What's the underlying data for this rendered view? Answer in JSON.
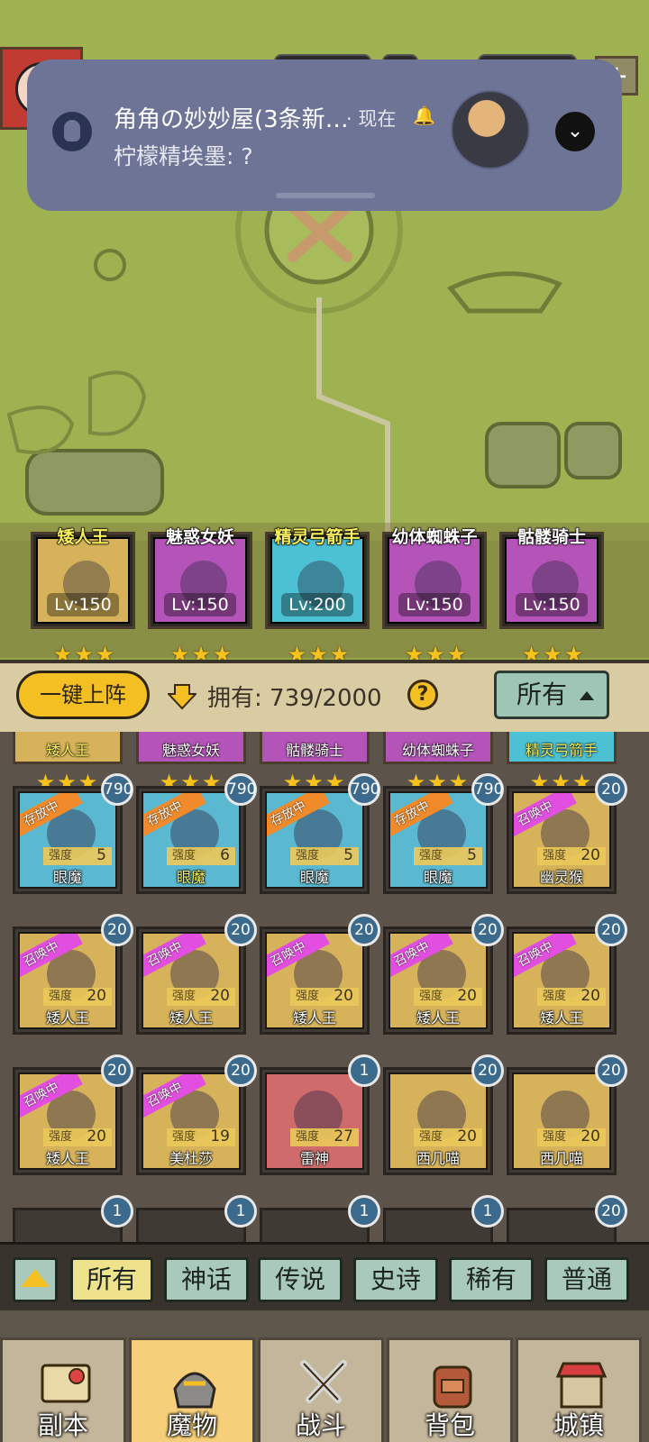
{
  "notification": {
    "title": "角角の妙妙屋(3条新…",
    "meta": "· 现在",
    "message": "柠檬精埃墨: ?"
  },
  "lineup": [
    {
      "name": "矮人王",
      "level": "Lv:150",
      "stars": "★★★",
      "name_color": "#f7f05c",
      "bg": "#d6b35a"
    },
    {
      "name": "魅惑女妖",
      "level": "Lv:150",
      "stars": "★★★",
      "name_color": "#ffffff",
      "bg": "#b454b8"
    },
    {
      "name": "精灵弓箭手",
      "level": "Lv:200",
      "stars": "★★★",
      "name_color": "#f7f05c",
      "bg": "#4cc1d4"
    },
    {
      "name": "幼体蜘蛛子",
      "level": "Lv:150",
      "stars": "★★★",
      "name_color": "#ffffff",
      "bg": "#b454b8"
    },
    {
      "name": "骷髅骑士",
      "level": "Lv:150",
      "stars": "★★★",
      "name_color": "#ffffff",
      "bg": "#b454b8"
    }
  ],
  "controls": {
    "deploy_label": "一键上阵",
    "owned_text": "拥有: 739/2000",
    "help": "?",
    "filter_label": "所有"
  },
  "partial_row": [
    {
      "name": "矮人王",
      "color": "#f7f05c",
      "bg": "#d6b35a"
    },
    {
      "name": "魅惑女妖",
      "color": "#ffffff",
      "bg": "#b454b8"
    },
    {
      "name": "骷髅骑士",
      "color": "#ffffff",
      "bg": "#b454b8"
    },
    {
      "name": "幼体蜘蛛子",
      "color": "#ffffff",
      "bg": "#b454b8"
    },
    {
      "name": "精灵弓箭手",
      "color": "#f7f05c",
      "bg": "#4cc1d4"
    }
  ],
  "partial_stars": "★★★",
  "strength_label": "强度",
  "monsters": [
    [
      {
        "name": "眼魔",
        "strength": "5",
        "badge": "790",
        "status": "存放中",
        "bg": "#5ab8d0",
        "name_color": "#ffffff"
      },
      {
        "name": "眼魔",
        "strength": "6",
        "badge": "790",
        "status": "存放中",
        "bg": "#5ab8d0",
        "name_color": "#f7f05c"
      },
      {
        "name": "眼魔",
        "strength": "5",
        "badge": "790",
        "status": "存放中",
        "bg": "#5ab8d0",
        "name_color": "#ffffff"
      },
      {
        "name": "眼魔",
        "strength": "5",
        "badge": "790",
        "status": "存放中",
        "bg": "#5ab8d0",
        "name_color": "#ffffff"
      },
      {
        "name": "幽灵猴",
        "strength": "20",
        "badge": "20",
        "status": "召唤中",
        "bg": "#d6b35a",
        "name_color": "#ffffff"
      }
    ],
    [
      {
        "name": "矮人王",
        "strength": "20",
        "badge": "20",
        "status": "召唤中",
        "bg": "#d6b35a",
        "name_color": "#ffffff"
      },
      {
        "name": "矮人王",
        "strength": "20",
        "badge": "20",
        "status": "召唤中",
        "bg": "#d6b35a",
        "name_color": "#ffffff"
      },
      {
        "name": "矮人王",
        "strength": "20",
        "badge": "20",
        "status": "召唤中",
        "bg": "#d6b35a",
        "name_color": "#ffffff"
      },
      {
        "name": "矮人王",
        "strength": "20",
        "badge": "20",
        "status": "召唤中",
        "bg": "#d6b35a",
        "name_color": "#ffffff"
      },
      {
        "name": "矮人王",
        "strength": "20",
        "badge": "20",
        "status": "召唤中",
        "bg": "#d6b35a",
        "name_color": "#ffffff"
      }
    ],
    [
      {
        "name": "矮人王",
        "strength": "20",
        "badge": "20",
        "status": "召唤中",
        "bg": "#d6b35a",
        "name_color": "#ffffff"
      },
      {
        "name": "美杜莎",
        "strength": "19",
        "badge": "20",
        "status": "召唤中",
        "bg": "#d6b35a",
        "name_color": "#ffffff"
      },
      {
        "name": "雷神",
        "strength": "27",
        "badge": "1",
        "status": "",
        "bg": "#cf6b6b",
        "name_color": "#ffffff"
      },
      {
        "name": "西几喵",
        "strength": "20",
        "badge": "20",
        "status": "",
        "bg": "#d6b35a",
        "name_color": "#ffffff"
      },
      {
        "name": "西几喵",
        "strength": "20",
        "badge": "20",
        "status": "",
        "bg": "#d6b35a",
        "name_color": "#ffffff"
      }
    ]
  ],
  "next_row_badges": [
    "1",
    "1",
    "1",
    "1",
    "20"
  ],
  "filters": [
    "所有",
    "神话",
    "传说",
    "史诗",
    "稀有",
    "普通"
  ],
  "nav": [
    {
      "label": "副本",
      "icon": "map-scroll-icon"
    },
    {
      "label": "魔物",
      "icon": "monster-helmet-icon"
    },
    {
      "label": "战斗",
      "icon": "crossed-swords-icon"
    },
    {
      "label": "背包",
      "icon": "backpack-icon"
    },
    {
      "label": "城镇",
      "icon": "shop-building-icon"
    }
  ],
  "colors": {
    "ribbon_stored": "#f08a2a",
    "ribbon_summon": "#e24fe0",
    "accent_gold": "#f4bf23",
    "star": "#f6c21b"
  }
}
